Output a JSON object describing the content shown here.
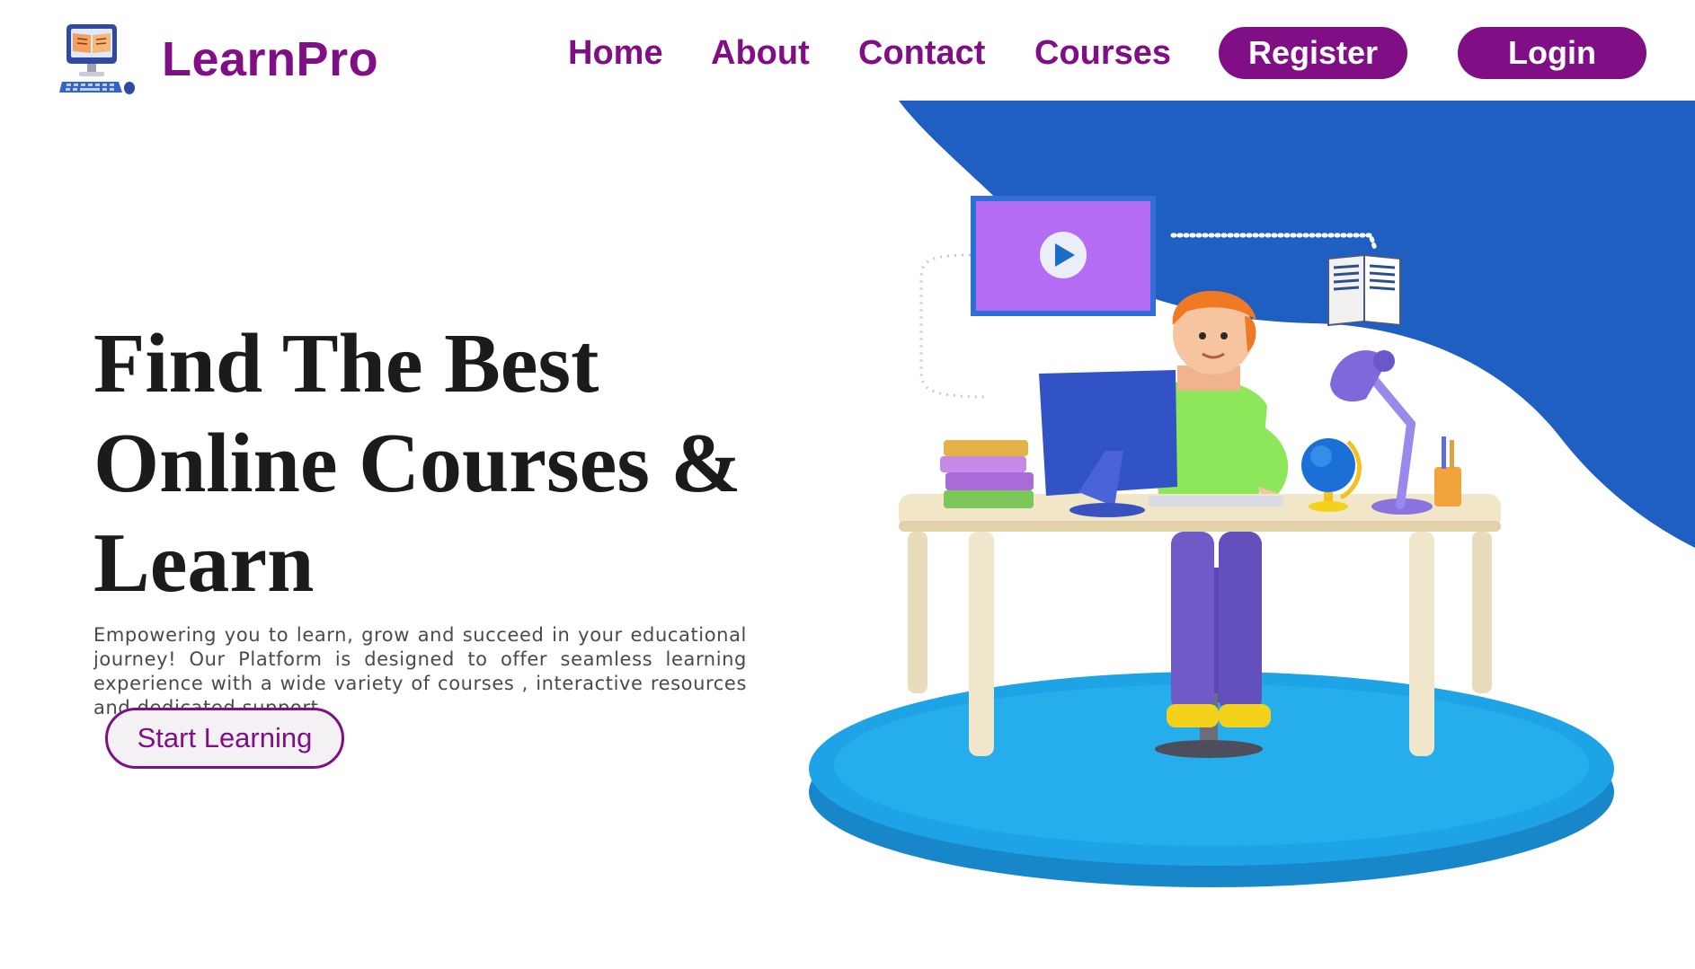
{
  "header": {
    "brand": "LearnPro",
    "logo_icon": "computer-book-icon",
    "nav": [
      "Home",
      "About",
      "Contact",
      "Courses"
    ],
    "register_label": "Register",
    "login_label": "Login"
  },
  "hero": {
    "title_lines": [
      "Find The Best",
      "Online Courses &",
      "Learn"
    ],
    "description": "Empowering you to learn, grow and succeed in your educational journey! Our Platform is designed to offer seamless learning experience with a wide variety of courses , interactive resources and dedicated support.",
    "cta_label": "Start Learning"
  },
  "illustration": {
    "icons": [
      "video-play-icon",
      "open-book-icon",
      "desk-lamp-icon",
      "globe-icon",
      "computer-monitor-icon",
      "books-stack-icon"
    ]
  },
  "colors": {
    "brand": "#800f86",
    "wave_blue": "#1e5fc1",
    "platform_blue": "#1ea3e6",
    "screen_purple": "#b46cf5"
  }
}
